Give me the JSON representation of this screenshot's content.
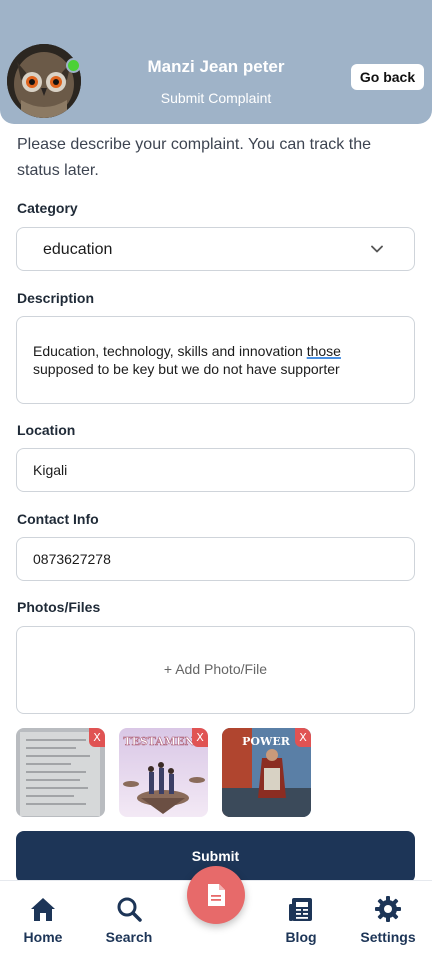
{
  "header": {
    "user_name": "Manzi Jean peter",
    "screen_title": "Submit Complaint",
    "back_label": "Go back",
    "status_color": "#4cd137"
  },
  "form": {
    "intro": "Please describe your complaint. You can track the status later.",
    "category": {
      "label": "Category",
      "value": "education"
    },
    "description": {
      "label": "Description",
      "value_before": "Education, technology, skills and innovation ",
      "value_underlined": "those",
      "value_after": " supposed to be key but we do not have supporter"
    },
    "location": {
      "label": "Location",
      "value": "Kigali"
    },
    "contact": {
      "label": "Contact Info",
      "value": "0873627278"
    },
    "photos": {
      "label": "Photos/Files",
      "add_label": "+ Add Photo/File",
      "remove_label": "X",
      "thumbnails": [
        {
          "name": "document-photo",
          "text": ""
        },
        {
          "name": "testament-poster",
          "text": "TESTAMENT"
        },
        {
          "name": "power-poster",
          "text": "POWER"
        }
      ]
    },
    "submit_label": "Submit"
  },
  "nav": {
    "items": [
      {
        "label": "Home",
        "icon": "home-icon"
      },
      {
        "label": "Search",
        "icon": "search-icon"
      },
      {
        "label": "Blog",
        "icon": "newspaper-icon"
      },
      {
        "label": "Settings",
        "icon": "gear-icon"
      }
    ],
    "fab_icon": "document-icon",
    "accent": "#1d3557",
    "fab_color": "#e76a6a"
  }
}
